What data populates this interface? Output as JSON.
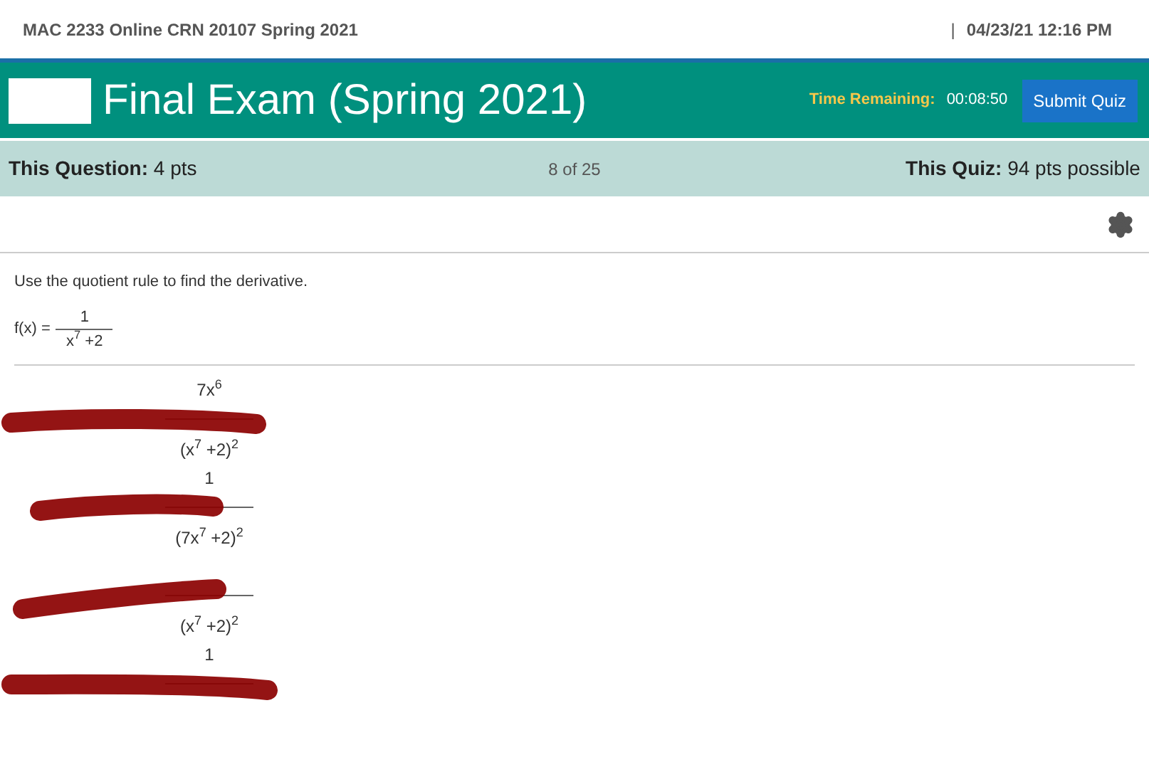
{
  "header": {
    "course": "MAC 2233 Online CRN 20107 Spring 2021",
    "separator": "|",
    "datetime": "04/23/21 12:16 PM"
  },
  "title_bar": {
    "title": "Final Exam (Spring 2021)",
    "time_label": "Time Remaining:",
    "time_value": "00:08:50",
    "submit": "Submit Quiz"
  },
  "info_bar": {
    "question_label": "This Question:",
    "question_pts": "4 pts",
    "progress": "8 of 25",
    "quiz_label": "This Quiz:",
    "quiz_pts": "94 pts possible"
  },
  "question": {
    "prompt": "Use the quotient rule to find the derivative.",
    "lhs": "f(x) =",
    "numerator": "1",
    "denominator": "x$^{7}$ +2"
  },
  "options": [
    {
      "numerator": "7x$^{6}$",
      "denominator": "(x$^{7}$ +2)$^{2}$"
    },
    {
      "numerator": "1",
      "denominator": "(7x$^{7}$ +2)$^{2}$"
    },
    {
      "denominator": "(x$^{7}$ +2)$^{2}$"
    },
    {
      "numerator": "1"
    }
  ]
}
